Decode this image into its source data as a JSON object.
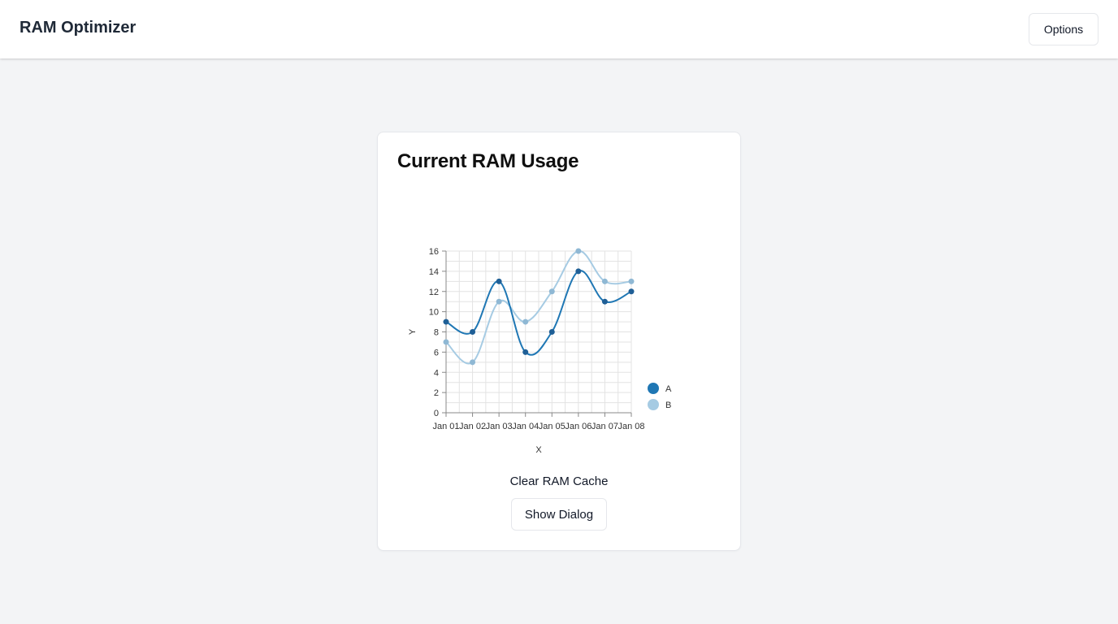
{
  "header": {
    "title": "RAM Optimizer",
    "options_label": "Options"
  },
  "card": {
    "title": "Current RAM Usage",
    "clear_label": "Clear RAM Cache",
    "dialog_button_label": "Show Dialog"
  },
  "chart_data": {
    "type": "line",
    "categories": [
      "Jan 01",
      "Jan 02",
      "Jan 03",
      "Jan 04",
      "Jan 05",
      "Jan 06",
      "Jan 07",
      "Jan 08"
    ],
    "series": [
      {
        "name": "A",
        "color": "#1f77b4",
        "values": [
          9,
          8,
          13,
          6,
          8,
          14,
          11,
          12
        ]
      },
      {
        "name": "B",
        "color": "#a6cbe3",
        "values": [
          7,
          5,
          11,
          9,
          12,
          16,
          13,
          13
        ]
      }
    ],
    "xlabel": "X",
    "ylabel": "Y",
    "ylim": [
      0,
      16
    ],
    "yticks": [
      0,
      2,
      4,
      6,
      8,
      10,
      12,
      14,
      16
    ],
    "grid": true,
    "legend": "right",
    "curve": "smooth"
  }
}
